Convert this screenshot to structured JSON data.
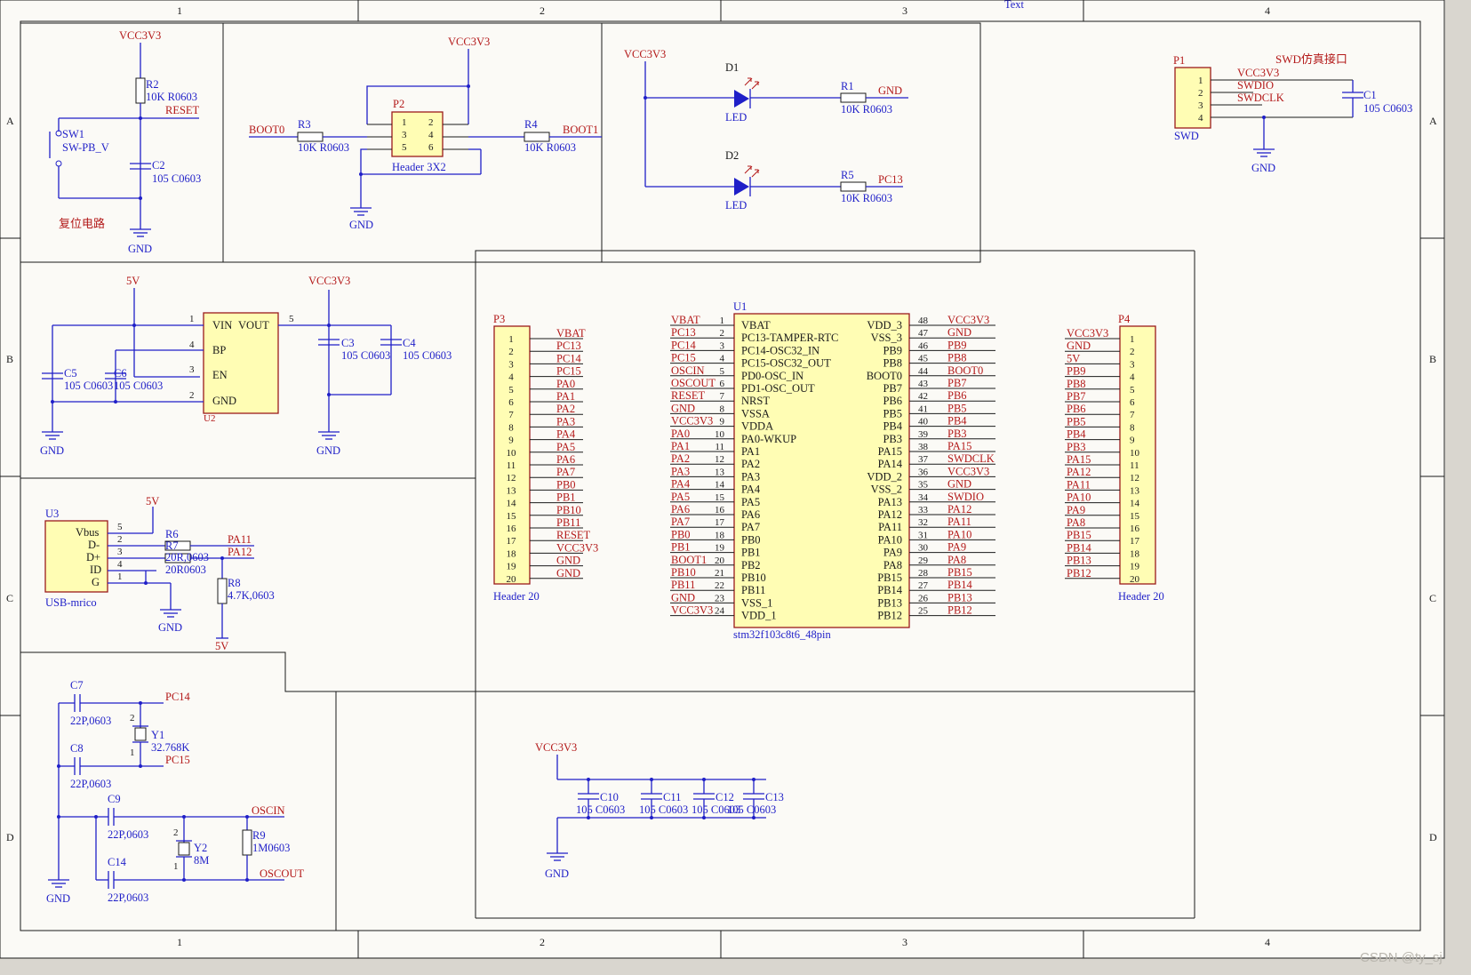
{
  "header": {
    "text_label": "Text"
  },
  "zones": {
    "cols": [
      "1",
      "2",
      "3",
      "4"
    ],
    "rows": [
      "A",
      "B",
      "C",
      "D"
    ]
  },
  "reset": {
    "vcc": "VCC3V3",
    "r2": "R2",
    "r2_val": "10K R0603",
    "reset": "RESET",
    "sw": "SW1",
    "sw_val": "SW-PB_V",
    "c2": "C2",
    "c2_val": "105 C0603",
    "title": "复位电路",
    "gnd": "GND"
  },
  "boot": {
    "vcc": "VCC3V3",
    "p2": "P2",
    "p2_val": "Header 3X2",
    "pins": [
      "1",
      "2",
      "3",
      "4",
      "5",
      "6"
    ],
    "boot0": "BOOT0",
    "boot1": "BOOT1",
    "r3": "R3",
    "r3_val": "10K R0603",
    "r4": "R4",
    "r4_val": "10K R0603",
    "gnd": "GND"
  },
  "led": {
    "vcc": "VCC3V3",
    "d1": "D1",
    "d2": "D2",
    "led": "LED",
    "r1": "R1",
    "r1_val": "10K R0603",
    "r5": "R5",
    "r5_val": "10K R0603",
    "gnd": "GND",
    "pc13": "PC13"
  },
  "swd": {
    "p1": "P1",
    "title": "SWD仿真接口",
    "pins": [
      "1",
      "2",
      "3",
      "4"
    ],
    "nets": [
      "VCC3V3",
      "SWDIO",
      "SWDCLK"
    ],
    "name": "SWD",
    "c1": "C1",
    "c1_val": "105 C0603",
    "gnd": "GND"
  },
  "ldo": {
    "v5": "5V",
    "vcc": "VCC3V3",
    "pins_left": [
      "VIN",
      "BP",
      "EN",
      "GND"
    ],
    "pin_out": "VOUT",
    "num_left": [
      "1",
      "4",
      "3",
      "2"
    ],
    "num_out": "5",
    "u2": "U2",
    "c5": "C5",
    "c6": "C6",
    "c3": "C3",
    "c4": "C4",
    "cap_val": "105 C0603",
    "c5_val": "105 C0603",
    "c6_val": "105 C0603",
    "gnd": "GND"
  },
  "usb": {
    "u3": "U3",
    "name": "USB-mrico",
    "pins": [
      "Vbus",
      "D-",
      "D+",
      "ID",
      "G"
    ],
    "nums": [
      "5",
      "2",
      "3",
      "4",
      "1"
    ],
    "v5": "5V",
    "r6": "R6",
    "r7": "R7",
    "r6_val": "20R,0603",
    "r7_val": "20R0603",
    "pa11": "PA11",
    "pa12": "PA12",
    "r8": "R8",
    "r8_val": "4.7K,0603",
    "v5b": "5V",
    "gnd": "GND"
  },
  "xtal": {
    "c7": "C7",
    "c7_val": "22P,0603",
    "c8": "C8",
    "c8_val": "22P,0603",
    "y1": "Y1",
    "y1_val": "32.768K",
    "pc14": "PC14",
    "pc15": "PC15",
    "c9": "C9",
    "c9_val": "22P,0603",
    "c14": "C14",
    "c14_val": "22P,0603",
    "y2": "Y2",
    "y2_val": "8M",
    "r9": "R9",
    "r9_val": "1M0603",
    "oscin": "OSCIN",
    "oscout": "OSCOUT",
    "gnd": "GND",
    "n1": "1",
    "n2": "2"
  },
  "p3": {
    "name": "P3",
    "type": "Header 20",
    "nums": [
      "1",
      "2",
      "3",
      "4",
      "5",
      "6",
      "7",
      "8",
      "9",
      "10",
      "11",
      "12",
      "13",
      "14",
      "15",
      "16",
      "17",
      "18",
      "19",
      "20"
    ],
    "nets": [
      "VBAT",
      "PC13",
      "PC14",
      "PC15",
      "PA0",
      "PA1",
      "PA2",
      "PA3",
      "PA4",
      "PA5",
      "PA6",
      "PA7",
      "PB0",
      "PB1",
      "PB10",
      "PB11",
      "RESET",
      "VCC3V3",
      "GND",
      "GND"
    ]
  },
  "p4": {
    "name": "P4",
    "type": "Header 20",
    "nums": [
      "1",
      "2",
      "3",
      "4",
      "5",
      "6",
      "7",
      "8",
      "9",
      "10",
      "11",
      "12",
      "13",
      "14",
      "15",
      "16",
      "17",
      "18",
      "19",
      "20"
    ],
    "nets": [
      "VCC3V3",
      "GND",
      "5V",
      "PB9",
      "PB8",
      "PB7",
      "PB6",
      "PB5",
      "PB4",
      "PB3",
      "PA15",
      "PA12",
      "PA11",
      "PA10",
      "PA9",
      "PA8",
      "PB15",
      "PB14",
      "PB13",
      "PB12"
    ]
  },
  "mcu": {
    "ref": "U1",
    "part": "stm32f103c8t6_48pin",
    "left_nums": [
      "1",
      "2",
      "3",
      "4",
      "5",
      "6",
      "7",
      "8",
      "9",
      "10",
      "11",
      "12",
      "13",
      "14",
      "15",
      "16",
      "17",
      "18",
      "19",
      "20",
      "21",
      "22",
      "23",
      "24"
    ],
    "left_pins": [
      "VBAT",
      "PC13-TAMPER-RTC",
      "PC14-OSC32_IN",
      "PC15-OSC32_OUT",
      "PD0-OSC_IN",
      "PD1-OSC_OUT",
      "NRST",
      "VSSA",
      "VDDA",
      "PA0-WKUP",
      "PA1",
      "PA2",
      "PA3",
      "PA4",
      "PA5",
      "PA6",
      "PA7",
      "PB0",
      "PB1",
      "PB2",
      "PB10",
      "PB11",
      "VSS_1",
      "VDD_1"
    ],
    "left_nets": [
      "VBAT",
      "PC13",
      "PC14",
      "PC15",
      "OSCIN",
      "OSCOUT",
      "RESET",
      "GND",
      "VCC3V3",
      "PA0",
      "PA1",
      "PA2",
      "PA3",
      "PA4",
      "PA5",
      "PA6",
      "PA7",
      "PB0",
      "PB1",
      "BOOT1",
      "PB10",
      "PB11",
      "GND",
      "VCC3V3"
    ],
    "right_nums": [
      "48",
      "47",
      "46",
      "45",
      "44",
      "43",
      "42",
      "41",
      "40",
      "39",
      "38",
      "37",
      "36",
      "35",
      "34",
      "33",
      "32",
      "31",
      "30",
      "29",
      "28",
      "27",
      "26",
      "25"
    ],
    "right_pins": [
      "VDD_3",
      "VSS_3",
      "PB9",
      "PB8",
      "BOOT0",
      "PB7",
      "PB6",
      "PB5",
      "PB4",
      "PB3",
      "PA15",
      "PA14",
      "VDD_2",
      "VSS_2",
      "PA13",
      "PA12",
      "PA11",
      "PA10",
      "PA9",
      "PA8",
      "PB15",
      "PB14",
      "PB13",
      "PB12"
    ],
    "right_nets": [
      "VCC3V3",
      "GND",
      "PB9",
      "PB8",
      "BOOT0",
      "PB7",
      "PB6",
      "PB5",
      "PB4",
      "PB3",
      "PA15",
      "SWDCLK",
      "VCC3V3",
      "GND",
      "SWDIO",
      "PA12",
      "PA11",
      "PA10",
      "PA9",
      "PA8",
      "PB15",
      "PB14",
      "PB13",
      "PB12"
    ]
  },
  "decap": {
    "vcc": "VCC3V3",
    "caps": [
      "C10",
      "C11",
      "C12",
      "C13"
    ],
    "vals": [
      "105 C0603",
      "105 C0603",
      "105 C0603",
      "105 C0603"
    ],
    "gnd": "GND"
  },
  "watermark": "CSDN @ty_sj"
}
